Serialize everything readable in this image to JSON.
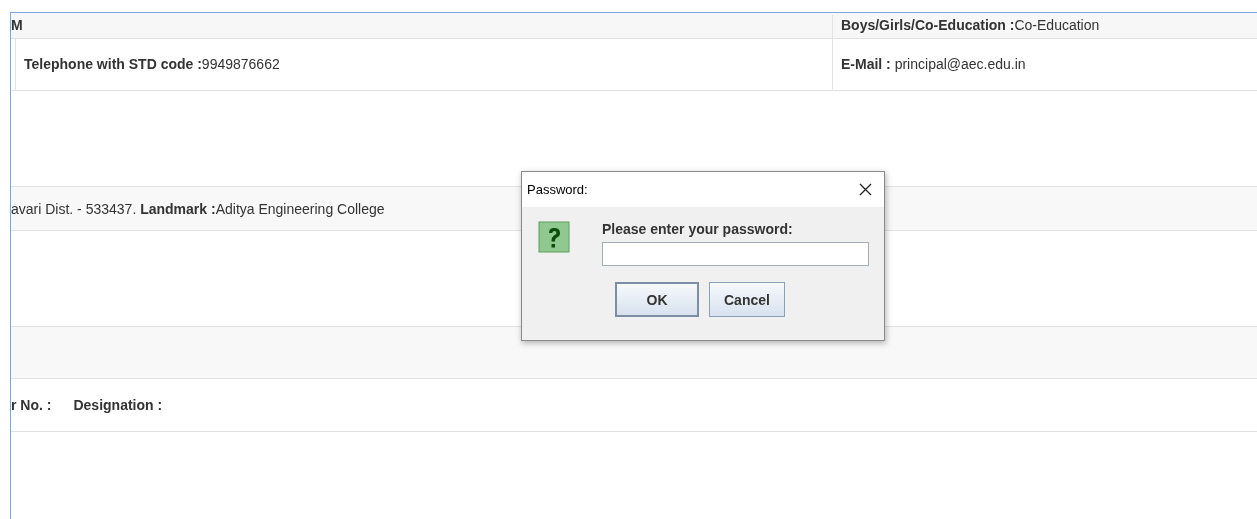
{
  "rows": [
    {
      "kind": "clipped",
      "cells": [
        "M",
        "**Boys/Girls/Co-Education :**Co-Education"
      ]
    },
    {
      "kind": "pair",
      "cells": [
        "**Telephone with STD code :**9949876662",
        "**E-Mail :** principal@aec.edu.in"
      ]
    },
    {
      "kind": "blank"
    },
    {
      "kind": "single",
      "cells": [
        "avari Dist. - 533437. **Landmark :**Aditya Engineering College"
      ]
    },
    {
      "kind": "blank"
    },
    {
      "kind": "shaded"
    },
    {
      "kind": "labels",
      "cells": [
        "r No. :",
        "Designation :"
      ]
    },
    {
      "kind": "blank"
    }
  ],
  "dialog": {
    "title": "Password:",
    "message": "Please enter your password:",
    "buttons": [
      {
        "label": "OK",
        "focused": true
      },
      {
        "label": "Cancel",
        "focused": false
      }
    ]
  }
}
